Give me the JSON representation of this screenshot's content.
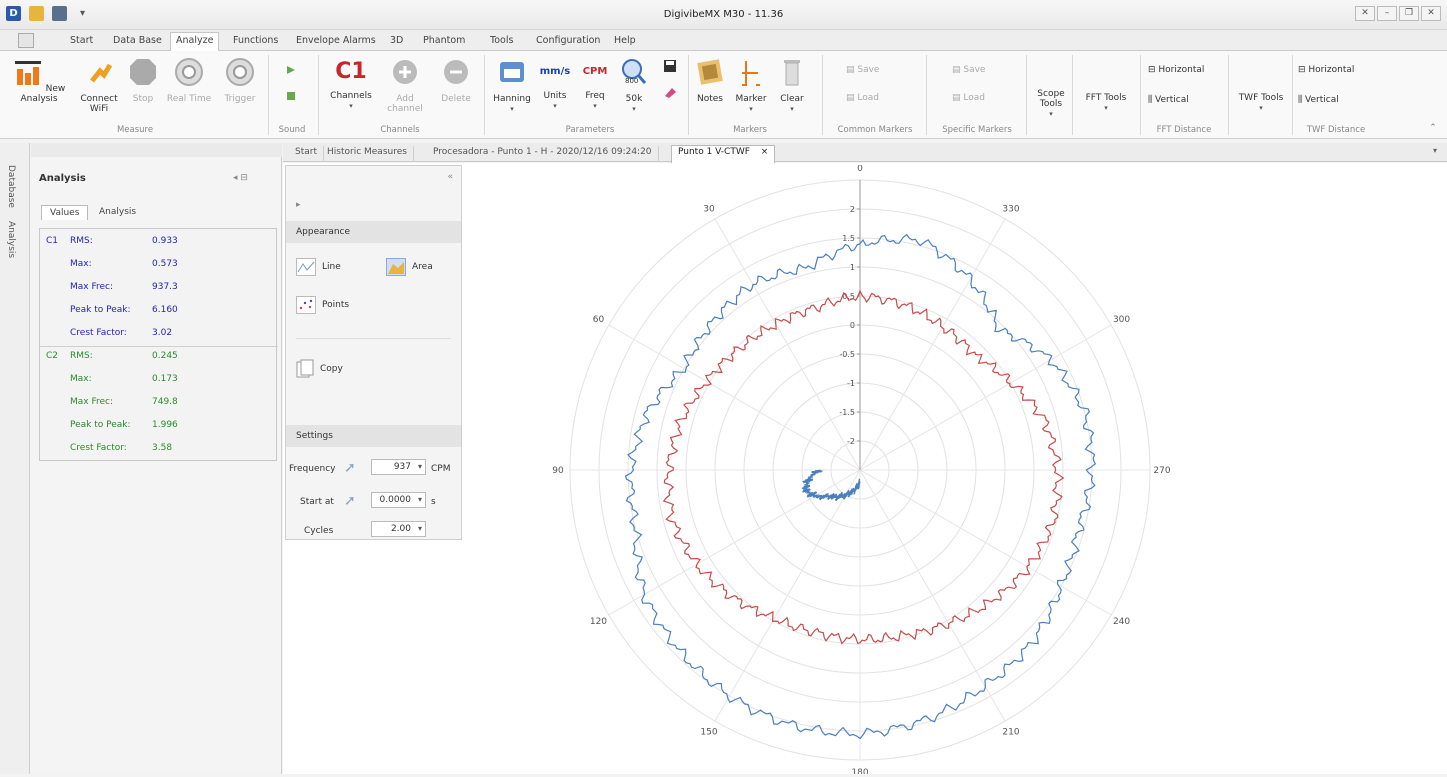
{
  "window": {
    "title": "DigivibeMX M30 - 11.36",
    "buttons": [
      "✕",
      "–",
      "❐",
      "✕"
    ]
  },
  "menu": {
    "items": [
      "Start",
      "Data Base",
      "Analyze",
      "Functions",
      "Envelope Alarms",
      "3D",
      "Phantom",
      "Tools",
      "Configuration",
      "Help"
    ],
    "active": "Analyze"
  },
  "ribbon": {
    "measure": {
      "label": "Measure",
      "new_analysis": "New Analysis",
      "connect_wifi": "Connect WiFi",
      "stop": "Stop",
      "real_time": "Real Time",
      "trigger": "Trigger"
    },
    "sound": {
      "label": "Sound"
    },
    "channels": {
      "label": "Channels",
      "channels": "Channels",
      "c1": "C1",
      "add_channel": "Add channel",
      "delete": "Delete"
    },
    "parameters": {
      "label": "Parameters",
      "hanning": "Hanning",
      "units": "Units",
      "units_value": "mm/s",
      "freq": "Freq",
      "freq_value": "CPM",
      "lines": "50k",
      "lines_icon": "800"
    },
    "markers": {
      "label": "Markers",
      "notes": "Notes",
      "marker": "Marker",
      "clear": "Clear"
    },
    "common_markers": {
      "label": "Common Markers",
      "save": "Save",
      "load": "Load"
    },
    "specific_markers": {
      "label": "Specific Markers",
      "save": "Save",
      "load": "Load"
    },
    "scope_tools": "Scope Tools",
    "fft_tools": "FFT Tools",
    "fft_distance": {
      "label": "FFT Distance",
      "horizontal": "Horizontal",
      "vertical": "Vertical"
    },
    "twf_tools": "TWF Tools",
    "twf_distance": {
      "label": "TWF Distance",
      "horizontal": "Horizontal",
      "vertical": "Vertical"
    }
  },
  "side_tabs": [
    "Database",
    "Analysis"
  ],
  "left_panel": {
    "title": "Analysis",
    "tabs": [
      "Values",
      "Analysis"
    ],
    "c1": [
      {
        "label": "RMS:",
        "value": "0.933"
      },
      {
        "label": "Max:",
        "value": "0.573"
      },
      {
        "label": "Max Frec:",
        "value": "937.3"
      },
      {
        "label": "Peak to Peak:",
        "value": "6.160"
      },
      {
        "label": "Crest Factor:",
        "value": "3.02"
      }
    ],
    "c2": [
      {
        "label": "RMS:",
        "value": "0.245"
      },
      {
        "label": "Max:",
        "value": "0.173"
      },
      {
        "label": "Max Frec:",
        "value": "749.8"
      },
      {
        "label": "Peak to Peak:",
        "value": "1.996"
      },
      {
        "label": "Crest Factor:",
        "value": "3.58"
      }
    ],
    "c1_label": "C1",
    "c2_label": "C2"
  },
  "doc_tabs": [
    "Start",
    "Historic Measures",
    "Procesadora - Punto 1 - H - 2020/12/16 09:24:20",
    "Punto 1 V-CTWF"
  ],
  "doc_tab_close": "×",
  "settings_panel": {
    "appearance_label": "Appearance",
    "line": "Line",
    "area": "Area",
    "points": "Points",
    "copy": "Copy",
    "settings_label": "Settings",
    "frequency_label": "Frequency",
    "frequency_value": "937",
    "frequency_unit": "CPM",
    "start_label": "Start at",
    "start_value": "0.0000",
    "start_unit": "s",
    "cycles_label": "Cycles",
    "cycles_value": "2.00"
  },
  "chart_data": {
    "type": "polar-line",
    "angle_labels": [
      "0",
      "30",
      "60",
      "90",
      "120",
      "150",
      "180",
      "210",
      "240",
      "270",
      "300",
      "330"
    ],
    "angle_direction": "counter-clockwise, 0 at top",
    "radial_ticks": [
      "2",
      "1.5",
      "1",
      "0.5",
      "0",
      "-0.5",
      "-1",
      "-1.5",
      "-2"
    ],
    "rlim": [
      -2.5,
      2.5
    ],
    "series": [
      {
        "color": "#4a7fc0",
        "theta": [
          0,
          15,
          30,
          45,
          60,
          75,
          90,
          105,
          120,
          135,
          150,
          165,
          180,
          195,
          210,
          225,
          240,
          255,
          270,
          285,
          300,
          315,
          330,
          345
        ],
        "r": [
          1.4,
          1.1,
          1.2,
          1.1,
          1.0,
          1.3,
          1.45,
          1.5,
          1.8,
          1.9,
          2.0,
          2.05,
          2.05,
          1.95,
          1.8,
          1.7,
          1.5,
          1.4,
          1.5,
          1.5,
          1.3,
          0.9,
          1.3,
          1.6
        ]
      },
      {
        "color": "#c84a4a",
        "theta": [
          0,
          15,
          30,
          45,
          60,
          75,
          90,
          105,
          120,
          135,
          150,
          165,
          180,
          195,
          210,
          225,
          240,
          255,
          270,
          285,
          300,
          315,
          330,
          345
        ],
        "r": [
          0.5,
          0.4,
          0.4,
          0.45,
          0.55,
          0.7,
          0.8,
          0.85,
          0.75,
          0.6,
          0.45,
          0.4,
          0.42,
          0.45,
          0.55,
          0.7,
          0.85,
          0.95,
          0.9,
          0.8,
          0.5,
          0.3,
          0.35,
          0.45
        ]
      },
      {
        "color": "#4a7fc0",
        "theta": [
          90,
          100,
          110,
          120,
          130,
          140,
          150,
          160,
          170,
          180
        ],
        "r": [
          -1.8,
          -1.6,
          -1.5,
          -1.6,
          -1.8,
          -1.9,
          -2.0,
          -2.1,
          -2.2,
          -2.3
        ]
      }
    ]
  }
}
